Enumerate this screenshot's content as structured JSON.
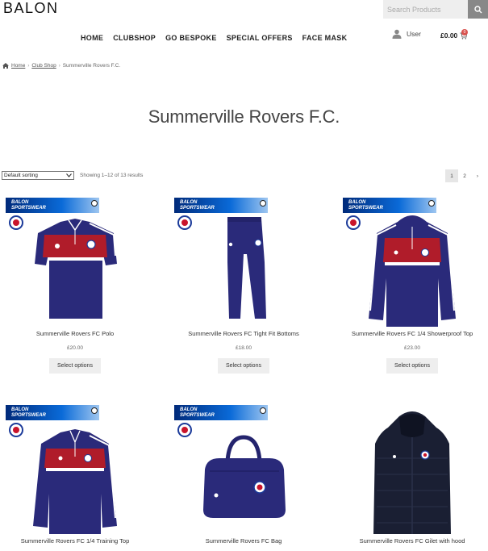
{
  "header": {
    "logo": "BALON",
    "search_placeholder": "Search Products",
    "user_label": "User",
    "cart_total": "£0.00",
    "cart_count": "0"
  },
  "nav": [
    {
      "label": "HOME"
    },
    {
      "label": "CLUBSHOP"
    },
    {
      "label": "GO BESPOKE"
    },
    {
      "label": "SPECIAL OFFERS"
    },
    {
      "label": "FACE MASK"
    }
  ],
  "breadcrumb": {
    "home": "Home",
    "club_shop": "Club Shop",
    "current": "Summerville Rovers F.C."
  },
  "page_title": "Summerville Rovers F.C.",
  "toolbar": {
    "sort_value": "Default sorting",
    "result_count": "Showing 1–12 of 13 results",
    "pages": [
      "1",
      "2"
    ],
    "next": "›"
  },
  "banner": {
    "line1": "BALON",
    "line2": "SPORTSWEAR"
  },
  "colors": {
    "navy": "#2a2a7a",
    "red": "#b01c2a",
    "banner_blue": "#0a6ad8"
  },
  "products": [
    {
      "name": "Summerville Rovers FC Polo",
      "price": "£20.00",
      "button": "Select options",
      "icon": "polo-shirt-icon"
    },
    {
      "name": "Summerville Rovers FC Tight Fit Bottoms",
      "price": "£18.00",
      "button": "Select options",
      "icon": "trousers-icon"
    },
    {
      "name": "Summerville Rovers FC 1/4 Showerproof Top",
      "price": "£23.00",
      "button": "Select options",
      "icon": "rain-jacket-icon"
    },
    {
      "name": "Summerville Rovers FC 1/4 Training Top",
      "icon": "training-top-icon"
    },
    {
      "name": "Summerville Rovers FC Bag",
      "icon": "holdall-bag-icon"
    },
    {
      "name": "Summerville Rovers FC Gilet with hood",
      "icon": "gilet-icon"
    }
  ]
}
